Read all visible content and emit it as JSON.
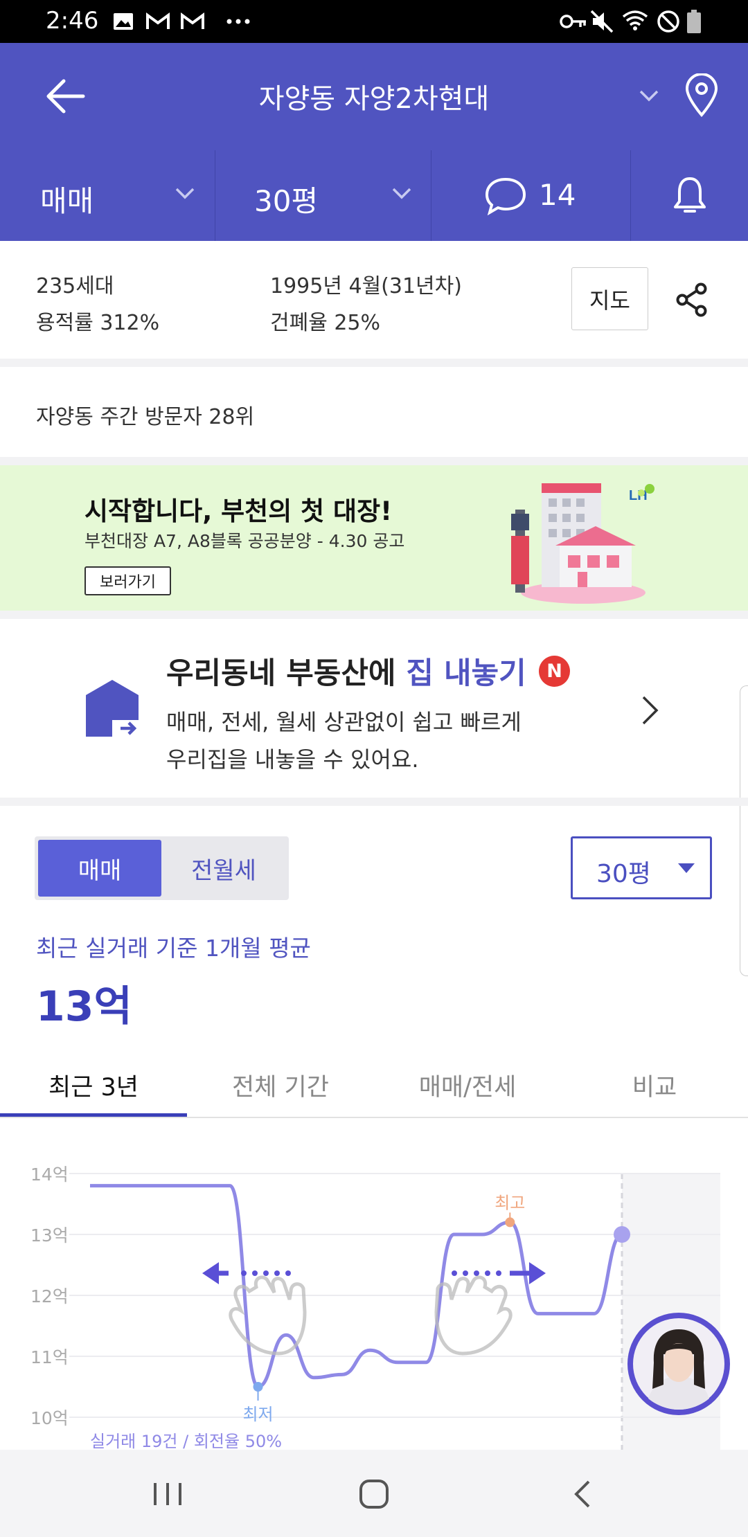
{
  "status_bar": {
    "time": "2:46",
    "icons": [
      "image-icon",
      "gmail-icon",
      "gmail-icon",
      "more-dots-icon",
      "key-icon",
      "mute-icon",
      "wifi-icon",
      "dnd-icon",
      "battery-icon"
    ]
  },
  "header": {
    "title": "자양동 자양2차현대",
    "back_icon": "back-arrow-icon",
    "dropdown_icon": "chevron-down-icon",
    "location_icon": "map-pin-icon"
  },
  "subbar": {
    "trade_type": "매매",
    "size": "30평",
    "comment_count": "14",
    "bell_icon": "bell-icon"
  },
  "info": {
    "households": "235세대",
    "floor_area_ratio": "용적률 312%",
    "built": "1995년 4월(31년차)",
    "coverage_ratio": "건폐율 25%",
    "map_button": "지도",
    "share_icon": "share-icon"
  },
  "ranking": {
    "text": "자양동 주간 방문자 28위"
  },
  "banner": {
    "title": "시작합니다, 부천의 첫 대장!",
    "subtitle": "부천대장 A7, A8블록 공공분양 - 4.30 공고",
    "button": "보러가기",
    "logo": "LH"
  },
  "sell_promo": {
    "title_prefix": "우리동네 부동산에 ",
    "title_accent": "집 내놓기",
    "badge": "N",
    "desc_line1": "매매, 전세, 월세 상관없이 쉽고 빠르게",
    "desc_line2": "우리집을 내놓을 수 있어요."
  },
  "price": {
    "toggle_sale": "매매",
    "toggle_rent": "전월세",
    "size_select": "30평",
    "caption": "최근 실거래 기준 1개월 평균",
    "value": "13억"
  },
  "tabs": [
    {
      "label": "최근 3년",
      "active": true
    },
    {
      "label": "전체 기간",
      "active": false
    },
    {
      "label": "매매/전세",
      "active": false
    },
    {
      "label": "비교",
      "active": false
    }
  ],
  "chart_data": {
    "type": "line",
    "y_ticks": [
      "14억",
      "13억",
      "12억",
      "11억",
      "10억"
    ],
    "ylim": [
      10,
      14
    ],
    "unit": "억",
    "series": [
      {
        "values": [
          13.8,
          13.8,
          13.8,
          13.8,
          13.8,
          13.8,
          10.5,
          11.35,
          10.65,
          10.7,
          11.1,
          10.9,
          10.9,
          13.0,
          13.0,
          13.2,
          11.7,
          11.7,
          11.7,
          13.0
        ]
      }
    ],
    "annotations": [
      {
        "label": "최고",
        "value": 13.2
      },
      {
        "label": "최저",
        "value": 10.5
      }
    ],
    "footer": "실거래 19건 / 회전율 50%"
  },
  "colors": {
    "brand": "#5054c0",
    "accent": "#3a3fb8",
    "banner_bg": "#e6f9d6",
    "line": "#8f89e6",
    "high": "#f0a67e",
    "low": "#7ea9ee"
  },
  "nav_bar": {
    "icons": [
      "recent-apps-icon",
      "home-icon",
      "back-icon"
    ]
  }
}
